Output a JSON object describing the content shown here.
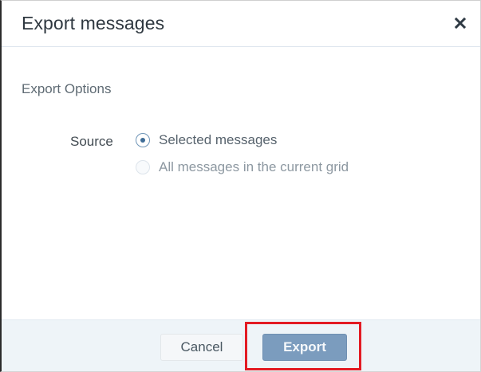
{
  "dialog": {
    "title": "Export messages",
    "close_icon": "close-x-icon"
  },
  "export_options": {
    "section_title": "Export Options",
    "source": {
      "label": "Source",
      "options": [
        {
          "label": "Selected messages",
          "checked": true,
          "disabled": false
        },
        {
          "label": "All messages in the current grid",
          "checked": false,
          "disabled": true
        }
      ]
    }
  },
  "footer": {
    "cancel_label": "Cancel",
    "export_label": "Export"
  },
  "colors": {
    "accent": "#7b9cbe",
    "highlight": "#e31b23",
    "footer_bg": "#eef4f8"
  }
}
